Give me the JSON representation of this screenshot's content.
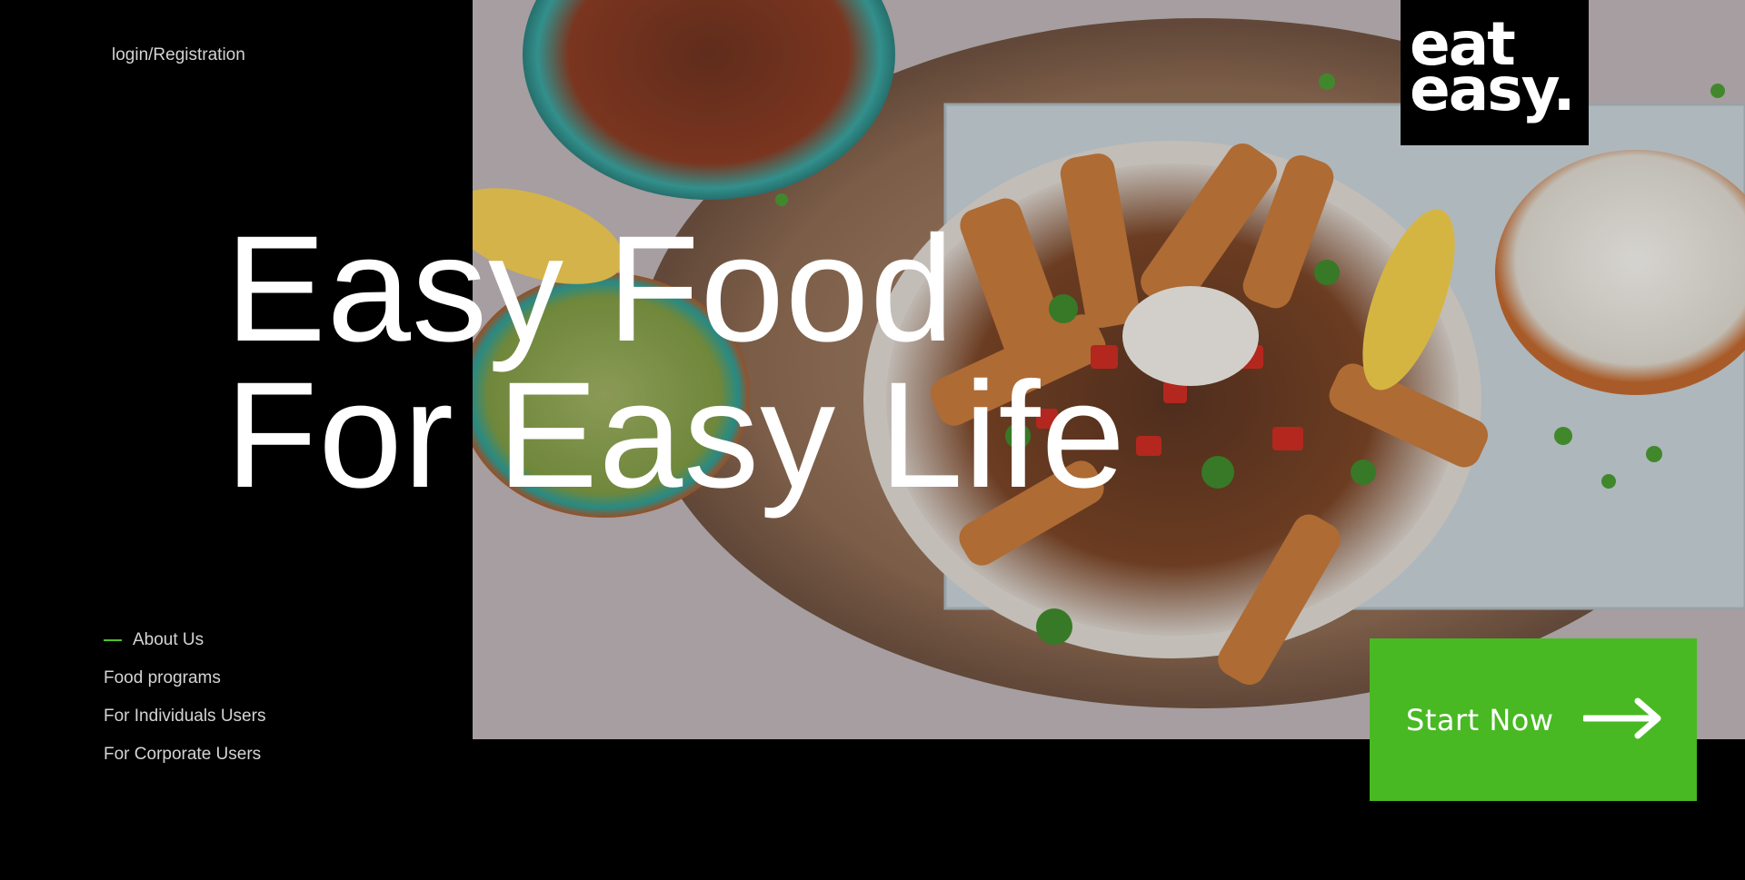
{
  "header": {
    "login_label": "login/Registration"
  },
  "logo": {
    "line1": "eat",
    "line2": "easy."
  },
  "hero": {
    "line1": "Easy Food",
    "line2": "For Easy Life",
    "image_icon": "food-photo"
  },
  "nav": {
    "items": [
      {
        "label": "About Us",
        "active": true
      },
      {
        "label": "Food programs"
      },
      {
        "label": "For Individuals Users"
      },
      {
        "label": "For Corporate Users"
      }
    ]
  },
  "cta": {
    "label": "Start Now",
    "icon": "arrow-right-icon"
  },
  "colors": {
    "background": "#000000",
    "accent_green": "#48b923",
    "text": "#ffffff"
  }
}
